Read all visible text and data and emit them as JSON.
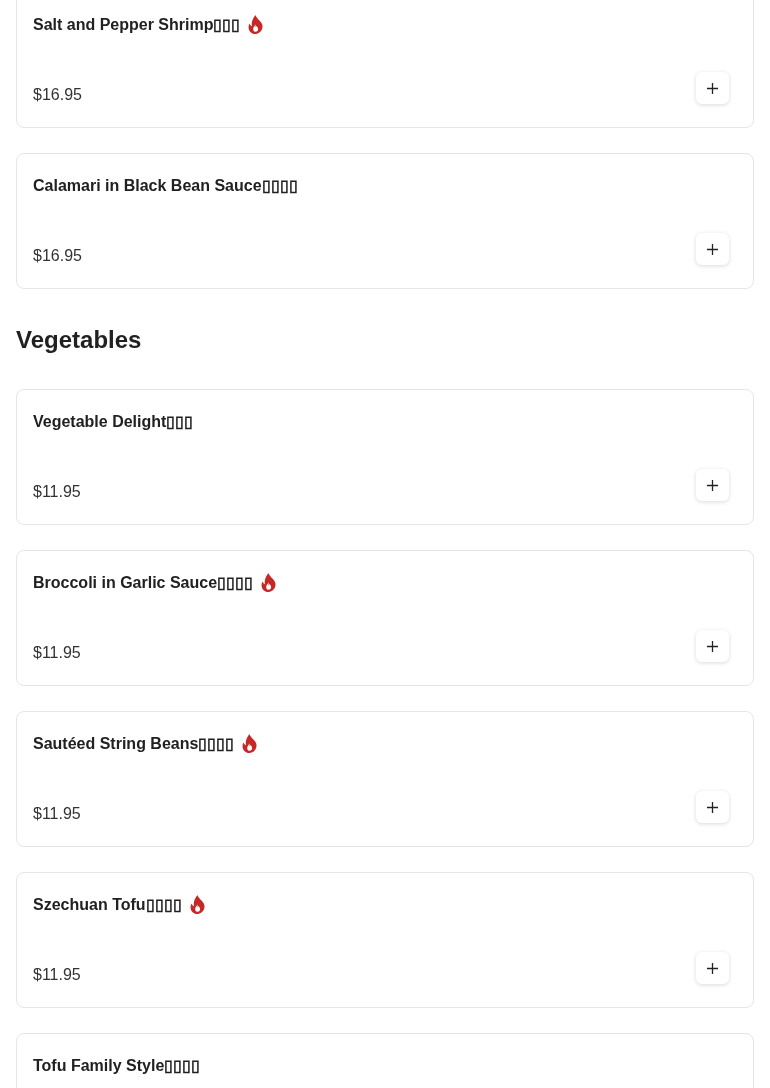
{
  "sections": [
    {
      "items": [
        {
          "name": "Salt and Pepper Shrimp▯▯▯",
          "spicy": true,
          "price": "$16.95"
        },
        {
          "name": "Calamari in Black Bean Sauce▯▯▯▯",
          "spicy": false,
          "price": "$16.95"
        }
      ]
    },
    {
      "heading": "Vegetables",
      "items": [
        {
          "name": "Vegetable Delight▯▯▯",
          "spicy": false,
          "price": "$11.95"
        },
        {
          "name": "Broccoli in Garlic Sauce▯▯▯▯",
          "spicy": true,
          "price": "$11.95"
        },
        {
          "name": "Sautéed String Beans▯▯▯▯",
          "spicy": true,
          "price": "$11.95"
        },
        {
          "name": "Szechuan Tofu▯▯▯▯",
          "spicy": true,
          "price": "$11.95"
        },
        {
          "name": "Tofu Family Style▯▯▯▯",
          "spicy": false
        }
      ]
    }
  ]
}
